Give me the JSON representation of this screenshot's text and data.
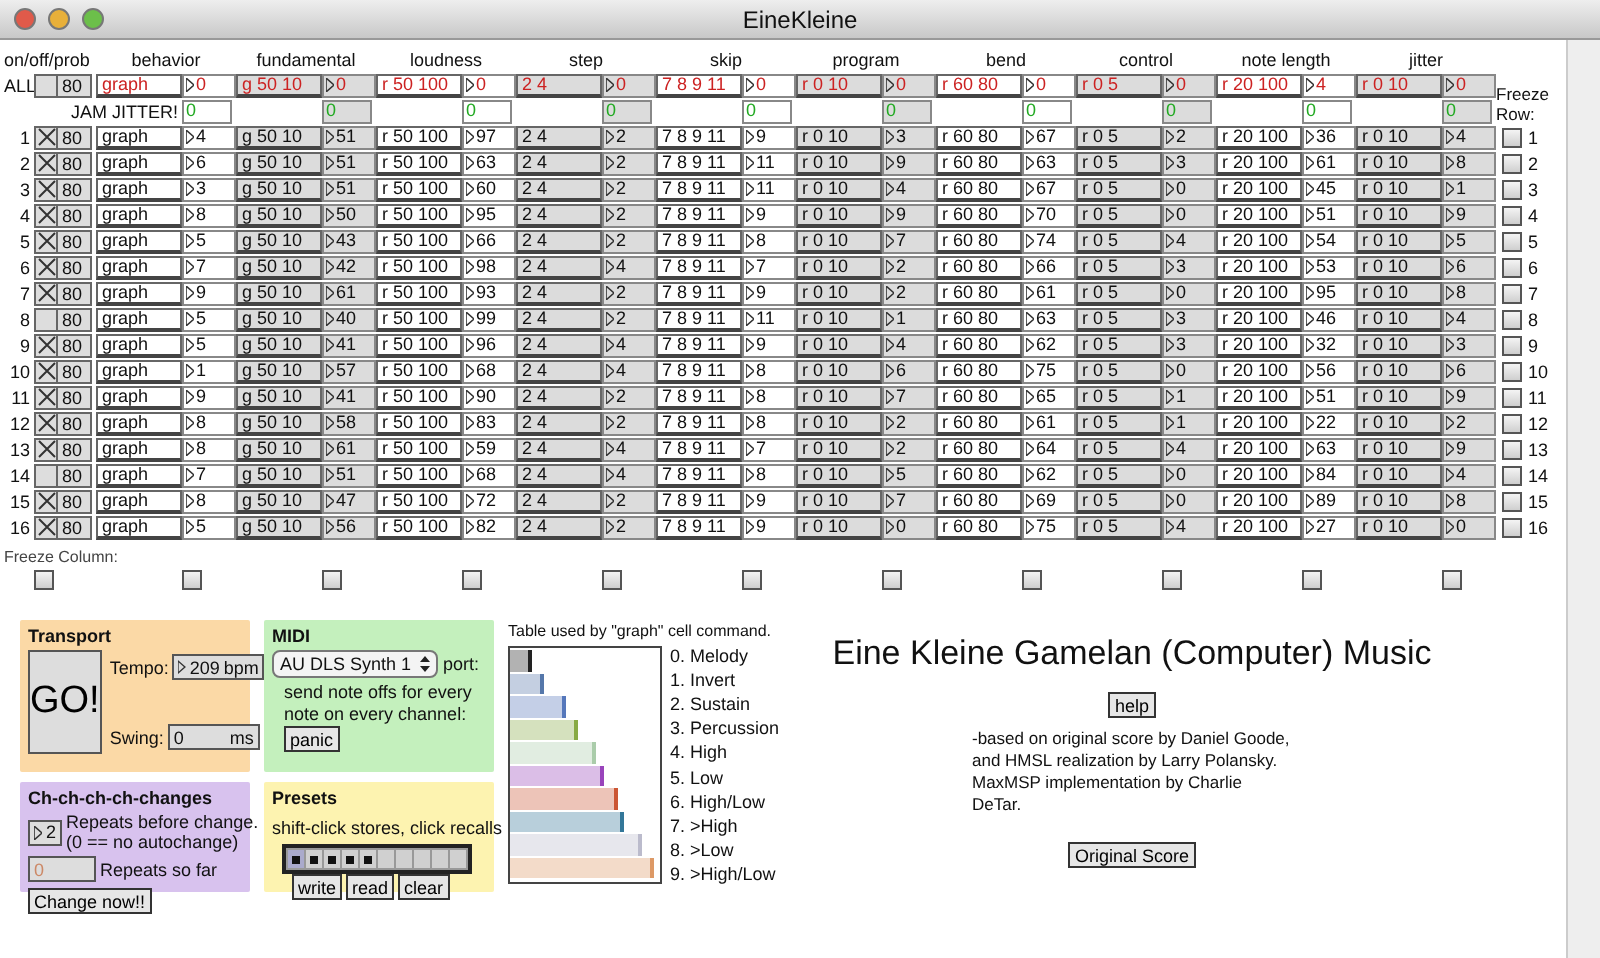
{
  "window": {
    "title": "EineKleine"
  },
  "grid": {
    "corner_label": "on/off/prob",
    "columns": [
      "behavior",
      "fundamental",
      "loudness",
      "step",
      "skip",
      "program",
      "bend",
      "control",
      "note length",
      "jitter"
    ],
    "all_row": {
      "label": "ALL",
      "on": false,
      "prob": "80",
      "texts": [
        "graph",
        "g 50 10",
        "r 50 100",
        "2 4",
        "7 8 9 11",
        "r 0 10",
        "r 60 80",
        "r 0 5",
        "r 20 100",
        "r 0 10"
      ],
      "numbers": [
        "0",
        "0",
        "0",
        "0",
        "0",
        "0",
        "0",
        "0",
        "4",
        "0"
      ]
    },
    "jam": {
      "label": "JAM JITTER!",
      "values": [
        "0",
        "0",
        "0",
        "0",
        "0",
        "0",
        "0",
        "0",
        "0",
        "0"
      ]
    },
    "freeze_row_label": "Freeze Row:",
    "rows": [
      {
        "index": "1",
        "on": true,
        "prob": "80",
        "texts": [
          "graph",
          "g 50 10",
          "r 50 100",
          "2 4",
          "7 8 9 11",
          "r 0 10",
          "r 60 80",
          "r 0 5",
          "r 20 100",
          "r 0 10"
        ],
        "numbers": [
          "4",
          "51",
          "97",
          "2",
          "9",
          "3",
          "67",
          "2",
          "36",
          "4"
        ],
        "frozen": false,
        "right_index": "1"
      },
      {
        "index": "2",
        "on": true,
        "prob": "80",
        "texts": [
          "graph",
          "g 50 10",
          "r 50 100",
          "2 4",
          "7 8 9 11",
          "r 0 10",
          "r 60 80",
          "r 0 5",
          "r 20 100",
          "r 0 10"
        ],
        "numbers": [
          "6",
          "51",
          "63",
          "2",
          "11",
          "9",
          "63",
          "3",
          "61",
          "8"
        ],
        "frozen": false,
        "right_index": "2"
      },
      {
        "index": "3",
        "on": true,
        "prob": "80",
        "texts": [
          "graph",
          "g 50 10",
          "r 50 100",
          "2 4",
          "7 8 9 11",
          "r 0 10",
          "r 60 80",
          "r 0 5",
          "r 20 100",
          "r 0 10"
        ],
        "numbers": [
          "3",
          "51",
          "60",
          "2",
          "11",
          "4",
          "67",
          "0",
          "45",
          "1"
        ],
        "frozen": false,
        "right_index": "3"
      },
      {
        "index": "4",
        "on": true,
        "prob": "80",
        "texts": [
          "graph",
          "g 50 10",
          "r 50 100",
          "2 4",
          "7 8 9 11",
          "r 0 10",
          "r 60 80",
          "r 0 5",
          "r 20 100",
          "r 0 10"
        ],
        "numbers": [
          "8",
          "50",
          "95",
          "2",
          "9",
          "9",
          "70",
          "0",
          "51",
          "9"
        ],
        "frozen": false,
        "right_index": "4"
      },
      {
        "index": "5",
        "on": true,
        "prob": "80",
        "texts": [
          "graph",
          "g 50 10",
          "r 50 100",
          "2 4",
          "7 8 9 11",
          "r 0 10",
          "r 60 80",
          "r 0 5",
          "r 20 100",
          "r 0 10"
        ],
        "numbers": [
          "5",
          "43",
          "66",
          "2",
          "8",
          "7",
          "74",
          "4",
          "54",
          "5"
        ],
        "frozen": false,
        "right_index": "5"
      },
      {
        "index": "6",
        "on": true,
        "prob": "80",
        "texts": [
          "graph",
          "g 50 10",
          "r 50 100",
          "2 4",
          "7 8 9 11",
          "r 0 10",
          "r 60 80",
          "r 0 5",
          "r 20 100",
          "r 0 10"
        ],
        "numbers": [
          "7",
          "42",
          "98",
          "4",
          "7",
          "2",
          "66",
          "3",
          "53",
          "6"
        ],
        "frozen": false,
        "right_index": "6"
      },
      {
        "index": "7",
        "on": true,
        "prob": "80",
        "texts": [
          "graph",
          "g 50 10",
          "r 50 100",
          "2 4",
          "7 8 9 11",
          "r 0 10",
          "r 60 80",
          "r 0 5",
          "r 20 100",
          "r 0 10"
        ],
        "numbers": [
          "9",
          "61",
          "93",
          "2",
          "9",
          "2",
          "61",
          "0",
          "95",
          "8"
        ],
        "frozen": false,
        "right_index": "7"
      },
      {
        "index": "8",
        "on": false,
        "prob": "80",
        "texts": [
          "graph",
          "g 50 10",
          "r 50 100",
          "2 4",
          "7 8 9 11",
          "r 0 10",
          "r 60 80",
          "r 0 5",
          "r 20 100",
          "r 0 10"
        ],
        "numbers": [
          "5",
          "40",
          "99",
          "2",
          "11",
          "1",
          "63",
          "3",
          "46",
          "4"
        ],
        "frozen": false,
        "right_index": "8"
      },
      {
        "index": "9",
        "on": true,
        "prob": "80",
        "texts": [
          "graph",
          "g 50 10",
          "r 50 100",
          "2 4",
          "7 8 9 11",
          "r 0 10",
          "r 60 80",
          "r 0 5",
          "r 20 100",
          "r 0 10"
        ],
        "numbers": [
          "5",
          "41",
          "96",
          "4",
          "9",
          "4",
          "62",
          "3",
          "32",
          "3"
        ],
        "frozen": false,
        "right_index": "9"
      },
      {
        "index": "10",
        "on": true,
        "prob": "80",
        "texts": [
          "graph",
          "g 50 10",
          "r 50 100",
          "2 4",
          "7 8 9 11",
          "r 0 10",
          "r 60 80",
          "r 0 5",
          "r 20 100",
          "r 0 10"
        ],
        "numbers": [
          "1",
          "57",
          "68",
          "4",
          "8",
          "6",
          "75",
          "0",
          "56",
          "6"
        ],
        "frozen": false,
        "right_index": "10"
      },
      {
        "index": "11",
        "on": true,
        "prob": "80",
        "texts": [
          "graph",
          "g 50 10",
          "r 50 100",
          "2 4",
          "7 8 9 11",
          "r 0 10",
          "r 60 80",
          "r 0 5",
          "r 20 100",
          "r 0 10"
        ],
        "numbers": [
          "9",
          "41",
          "90",
          "2",
          "8",
          "7",
          "65",
          "1",
          "51",
          "9"
        ],
        "frozen": false,
        "right_index": "11"
      },
      {
        "index": "12",
        "on": true,
        "prob": "80",
        "texts": [
          "graph",
          "g 50 10",
          "r 50 100",
          "2 4",
          "7 8 9 11",
          "r 0 10",
          "r 60 80",
          "r 0 5",
          "r 20 100",
          "r 0 10"
        ],
        "numbers": [
          "8",
          "58",
          "83",
          "2",
          "8",
          "2",
          "61",
          "1",
          "22",
          "2"
        ],
        "frozen": false,
        "right_index": "12"
      },
      {
        "index": "13",
        "on": true,
        "prob": "80",
        "texts": [
          "graph",
          "g 50 10",
          "r 50 100",
          "2 4",
          "7 8 9 11",
          "r 0 10",
          "r 60 80",
          "r 0 5",
          "r 20 100",
          "r 0 10"
        ],
        "numbers": [
          "8",
          "61",
          "59",
          "4",
          "7",
          "2",
          "64",
          "4",
          "63",
          "9"
        ],
        "frozen": false,
        "right_index": "13"
      },
      {
        "index": "14",
        "on": false,
        "prob": "80",
        "texts": [
          "graph",
          "g 50 10",
          "r 50 100",
          "2 4",
          "7 8 9 11",
          "r 0 10",
          "r 60 80",
          "r 0 5",
          "r 20 100",
          "r 0 10"
        ],
        "numbers": [
          "7",
          "51",
          "68",
          "4",
          "8",
          "5",
          "62",
          "0",
          "84",
          "4"
        ],
        "frozen": false,
        "right_index": "14"
      },
      {
        "index": "15",
        "on": true,
        "prob": "80",
        "texts": [
          "graph",
          "g 50 10",
          "r 50 100",
          "2 4",
          "7 8 9 11",
          "r 0 10",
          "r 60 80",
          "r 0 5",
          "r 20 100",
          "r 0 10"
        ],
        "numbers": [
          "8",
          "47",
          "72",
          "2",
          "9",
          "7",
          "69",
          "0",
          "89",
          "8"
        ],
        "frozen": false,
        "right_index": "15"
      },
      {
        "index": "16",
        "on": true,
        "prob": "80",
        "texts": [
          "graph",
          "g 50 10",
          "r 50 100",
          "2 4",
          "7 8 9 11",
          "r 0 10",
          "r 60 80",
          "r 0 5",
          "r 20 100",
          "r 0 10"
        ],
        "numbers": [
          "5",
          "56",
          "82",
          "2",
          "9",
          "0",
          "75",
          "4",
          "27",
          "0"
        ],
        "frozen": false,
        "right_index": "16"
      }
    ],
    "freeze_column_label": "Freeze Column:",
    "freeze_columns": [
      {
        "frozen": false
      },
      {
        "frozen": false
      },
      {
        "frozen": false
      },
      {
        "frozen": false
      },
      {
        "frozen": false
      },
      {
        "frozen": false
      },
      {
        "frozen": false
      },
      {
        "frozen": false
      },
      {
        "frozen": false
      },
      {
        "frozen": false
      },
      {
        "frozen": false
      }
    ]
  },
  "transport": {
    "title": "Transport",
    "go_button": "GO!",
    "tempo_label": "Tempo:",
    "tempo": "209",
    "tempo_unit": "bpm",
    "swing_label": "Swing:",
    "swing": "0",
    "swing_unit": "ms"
  },
  "changes": {
    "title": "Ch-ch-ch-ch-changes",
    "repeats": "2",
    "repeats_label": "Repeats before change.",
    "repeats_note": "(0 == no autochange)",
    "so_far": "0",
    "so_far_label": "Repeats so far",
    "button": "Change now!!"
  },
  "midi": {
    "title": "MIDI",
    "device": "AU DLS Synth 1",
    "port_label": "port:",
    "note": "send note offs for every note on every channel:",
    "panic_button": "panic"
  },
  "presets": {
    "title": "Presets",
    "hint": "shift-click stores, click recalls",
    "slots": [
      {
        "stored": true,
        "selected": true
      },
      {
        "stored": true,
        "selected": false
      },
      {
        "stored": true,
        "selected": false
      },
      {
        "stored": true,
        "selected": false
      },
      {
        "stored": true,
        "selected": false
      },
      {
        "stored": false,
        "selected": false
      },
      {
        "stored": false,
        "selected": false
      },
      {
        "stored": false,
        "selected": false
      },
      {
        "stored": false,
        "selected": false
      },
      {
        "stored": false,
        "selected": false
      }
    ],
    "buttons": [
      "write",
      "read",
      "clear"
    ]
  },
  "graph_table": {
    "caption": "Table used by \"graph\" cell command.",
    "entries": [
      {
        "label": "0. Melody",
        "level": 0.14,
        "color": "#222222"
      },
      {
        "label": "1. Invert",
        "level": 0.22,
        "color": "#5577aa"
      },
      {
        "label": "2. Sustain",
        "level": 0.37,
        "color": "#5577bb"
      },
      {
        "label": "3. Percussion",
        "level": 0.45,
        "color": "#88aa44"
      },
      {
        "label": "4. High",
        "level": 0.57,
        "color": "#aaccaa"
      },
      {
        "label": "5. Low",
        "level": 0.63,
        "color": "#9944bb"
      },
      {
        "label": "6. High/Low",
        "level": 0.72,
        "color": "#cc5533"
      },
      {
        "label": "7. >High",
        "level": 0.76,
        "color": "#337799"
      },
      {
        "label": "8. >Low",
        "level": 0.88,
        "color": "#bbbbcc"
      },
      {
        "label": "9. >High/Low",
        "level": 0.96,
        "color": "#dd9966"
      }
    ]
  },
  "info": {
    "title": "Eine Kleine Gamelan (Computer) Music",
    "help_button": "help",
    "credits": "-based on original score by Daniel Goode, and HMSL realization by Larry Polansky. MaxMSP implementation by Charlie DeTar.",
    "score_button": "Original Score"
  }
}
